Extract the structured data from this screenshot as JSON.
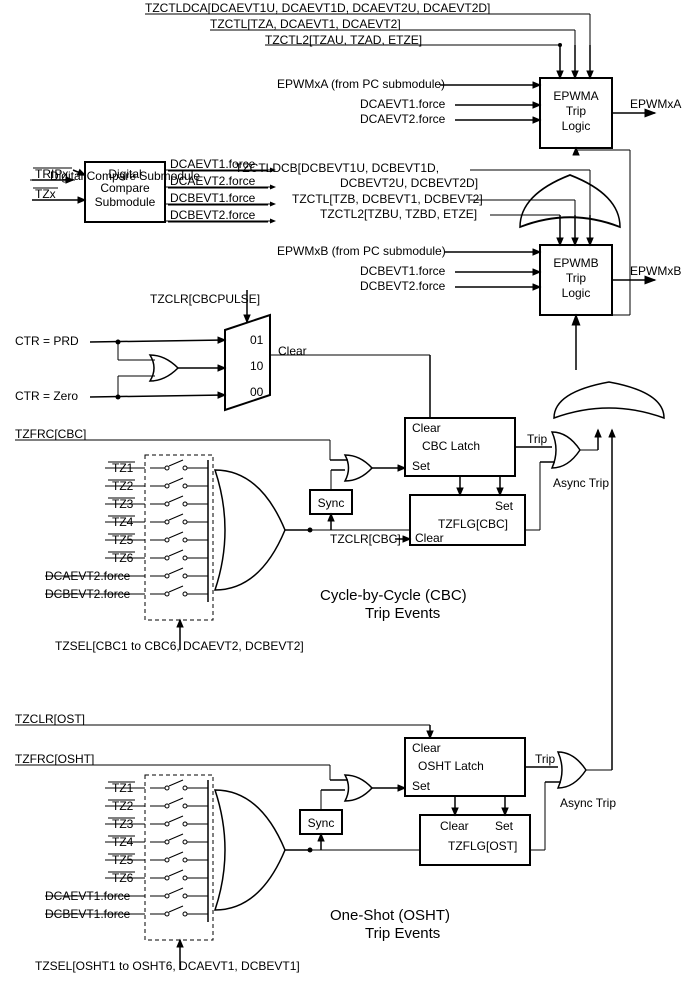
{
  "dcs": {
    "in1": "TRIPx",
    "in2": "TZx",
    "name": "Digital Compare Submodule",
    "o1": "DCAEVT1.force",
    "o2": "DCAEVT2.force",
    "o3": "DCBEVT1.force",
    "o4": "DCBEVT2.force"
  },
  "trip_logic_a": {
    "title": "EPWMA Trip Logic",
    "out": "EPWMxA",
    "cfg1": "TZCTLDCA[DCAEVT1U, DCAEVT1D, DCAEVT2U, DCAEVT2D]",
    "cfg2": "TZCTL[TZA, DCAEVT1, DCAEVT2]",
    "cfg3": "TZCTL2[TZAU, TZAD, ETZE]",
    "in1": "EPWMxA (from PC submodule)",
    "in2": "DCAEVT1.force",
    "in3": "DCAEVT2.force"
  },
  "trip_logic_b": {
    "title": "EPWMB Trip Logic",
    "out": "EPWMxB",
    "cfg1": "TZCTLDCB[DCBEVT1U, DCBEVT1D,",
    "cfg1b": "DCBEVT2U, DCBEVT2D]",
    "cfg2": "TZCTL[TZB, DCBEVT1, DCBEVT2]",
    "cfg3": "TZCTL2[TZBU, TZBD, ETZE]",
    "in1": "EPWMxB (from PC submodule)",
    "in2": "DCBEVT1.force",
    "in3": "DCBEVT2.force"
  },
  "mux": {
    "sel": "TZCLR[CBCPULSE]",
    "v01": "01",
    "v10": "10",
    "v00": "00",
    "out": "Clear"
  },
  "ctr": {
    "prd": "CTR = PRD",
    "zero": "CTR = Zero"
  },
  "tz": {
    "t1": "TZ1",
    "t2": "TZ2",
    "t3": "TZ3",
    "t4": "TZ4",
    "t5": "TZ5",
    "t6": "TZ6"
  },
  "cbc": {
    "title": "Cycle-by-Cycle (CBC)",
    "title2": "Trip Events",
    "force": "TZFRC[CBC]",
    "sync": "Sync",
    "latch": {
      "clear": "Clear",
      "name": "CBC Latch",
      "set": "Set"
    },
    "flag": {
      "set": "Set",
      "name": "TZFLG[CBC]",
      "clear": "Clear",
      "clr_in": "TZCLR[CBC]"
    },
    "trip": "Trip",
    "async": "Async Trip",
    "inA": "DCAEVT2.force",
    "inB": "DCBEVT2.force",
    "tzsel": "TZSEL[CBC1 to CBC6, DCAEVT2, DCBEVT2]"
  },
  "osht": {
    "title": "One-Shot (OSHT)",
    "title2": "Trip Events",
    "clr": "TZCLR[OST]",
    "force": "TZFRC[OSHT]",
    "sync": "Sync",
    "latch": {
      "clear": "Clear",
      "name": "OSHT Latch",
      "set": "Set"
    },
    "flag": {
      "set": "Set",
      "name": "TZFLG[OST]",
      "clear": "Clear"
    },
    "trip": "Trip",
    "async": "Async Trip",
    "inA": "DCAEVT1.force",
    "inB": "DCBEVT1.force",
    "tzsel": "TZSEL[OSHT1 to OSHT6, DCAEVT1, DCBEVT1]"
  }
}
